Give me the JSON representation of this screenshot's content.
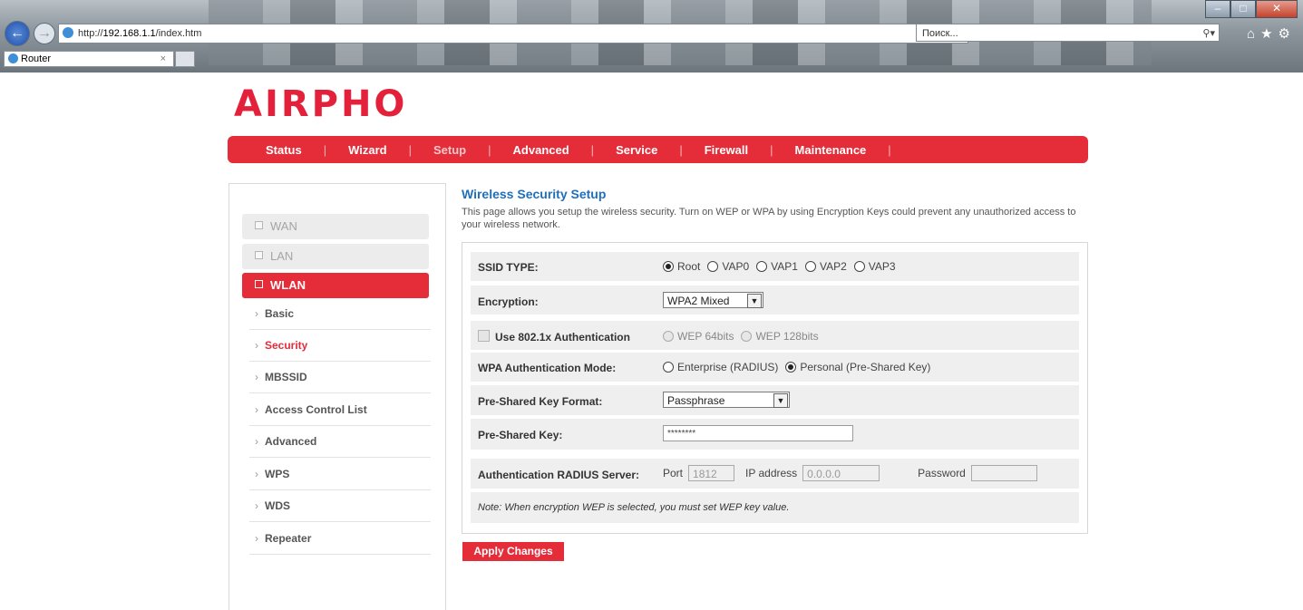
{
  "browser": {
    "url_prefix": "http://",
    "url_host": "192.168.1.1",
    "url_path": "/index.htm",
    "search_placeholder": "Поиск...",
    "tab_title": "Router"
  },
  "brand": {
    "logo": "AIRPHO",
    "accent": "#e52c39"
  },
  "menu": [
    "Status",
    "Wizard",
    "Setup",
    "Advanced",
    "Service",
    "Firewall",
    "Maintenance"
  ],
  "menu_active": "Setup",
  "sidebar": {
    "tabs": [
      "WAN",
      "LAN",
      "WLAN"
    ],
    "active_tab": "WLAN",
    "items": [
      "Basic",
      "Security",
      "MBSSID",
      "Access Control List",
      "Advanced",
      "WPS",
      "WDS",
      "Repeater"
    ],
    "active_item": "Security"
  },
  "page": {
    "title": "Wireless Security Setup",
    "description": "This page allows you setup the wireless security. Turn on WEP or WPA by using Encryption Keys could prevent any unauthorized access to your wireless network."
  },
  "form": {
    "ssid_type": {
      "label": "SSID TYPE:",
      "options": [
        "Root",
        "VAP0",
        "VAP1",
        "VAP2",
        "VAP3"
      ],
      "selected": "Root"
    },
    "encryption": {
      "label": "Encryption:",
      "value": "WPA2 Mixed"
    },
    "auth8021x": {
      "label": "Use 802.1x Authentication",
      "options": [
        "WEP 64bits",
        "WEP 128bits"
      ]
    },
    "wpa_mode": {
      "label": "WPA Authentication Mode:",
      "options": [
        "Enterprise (RADIUS)",
        "Personal (Pre-Shared Key)"
      ],
      "selected": "Personal (Pre-Shared Key)"
    },
    "psk_format": {
      "label": "Pre-Shared Key Format:",
      "value": "Passphrase"
    },
    "psk": {
      "label": "Pre-Shared Key:",
      "value": "********"
    },
    "radius": {
      "label": "Authentication RADIUS Server:",
      "port_label": "Port",
      "port": "1812",
      "ip_label": "IP address",
      "ip": "0.0.0.0",
      "password_label": "Password",
      "password": ""
    },
    "note": "Note: When encryption WEP is selected, you must set WEP key value."
  },
  "apply_label": "Apply Changes"
}
